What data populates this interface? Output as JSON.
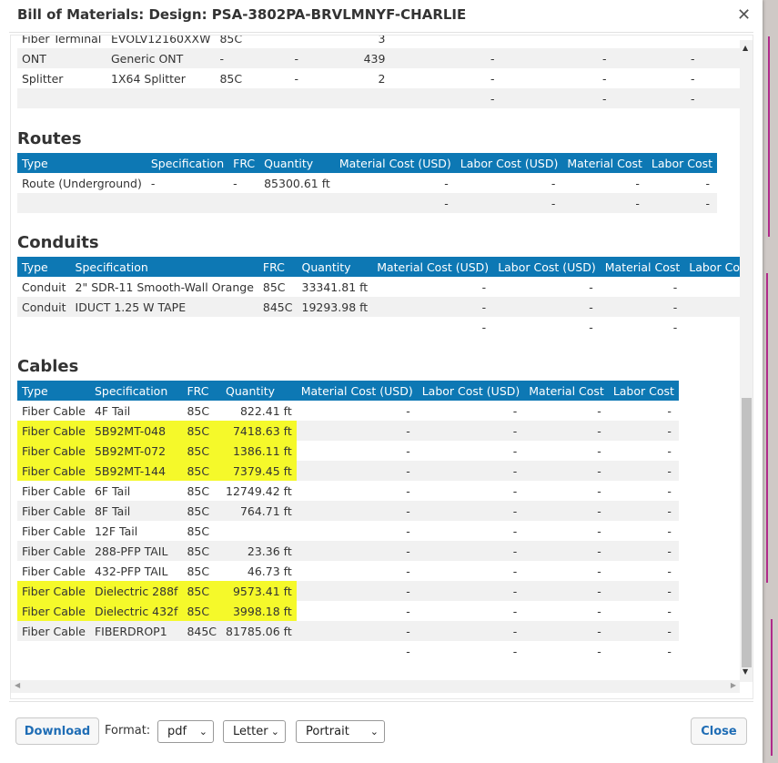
{
  "title": "Bill of Materials: Design: PSA-3802PA-BRVLMNYF-CHARLIE",
  "top_partial": {
    "rows": [
      [
        "Fiber Terminal",
        "EVOLV12160XXW",
        "85C",
        "",
        "3",
        "",
        "",
        "",
        ""
      ],
      [
        "ONT",
        "Generic ONT",
        "-",
        "-",
        "439",
        "-",
        "-",
        "-",
        "-"
      ],
      [
        "Splitter",
        "1X64 Splitter",
        "85C",
        "-",
        "2",
        "-",
        "-",
        "-",
        "-"
      ],
      [
        "",
        "",
        "",
        "",
        "",
        "-",
        "-",
        "-",
        "-"
      ]
    ]
  },
  "routes": {
    "heading": "Routes",
    "columns": [
      "Type",
      "Specification",
      "FRC",
      "Quantity",
      "Material Cost (USD)",
      "Labor Cost (USD)",
      "Material Cost",
      "Labor Cost"
    ],
    "rows": [
      [
        "Route (Underground)",
        "-",
        "-",
        "85300.61 ft",
        "-",
        "-",
        "-",
        "-"
      ],
      [
        "",
        "",
        "",
        "",
        "-",
        "-",
        "-",
        "-"
      ]
    ]
  },
  "conduits": {
    "heading": "Conduits",
    "columns": [
      "Type",
      "Specification",
      "FRC",
      "Quantity",
      "Material Cost (USD)",
      "Labor Cost (USD)",
      "Material Cost",
      "Labor Cost"
    ],
    "rows": [
      [
        "Conduit",
        "2\" SDR-11 Smooth-Wall Orange",
        "85C",
        "33341.81 ft",
        "-",
        "-",
        "-",
        "-"
      ],
      [
        "Conduit",
        "IDUCT 1.25 W TAPE",
        "845C",
        "19293.98 ft",
        "-",
        "-",
        "-",
        "-"
      ],
      [
        "",
        "",
        "",
        "",
        "-",
        "-",
        "-",
        "-"
      ]
    ]
  },
  "cables": {
    "heading": "Cables",
    "columns": [
      "Type",
      "Specification",
      "FRC",
      "Quantity",
      "Material Cost (USD)",
      "Labor Cost (USD)",
      "Material Cost",
      "Labor Cost"
    ],
    "rows": [
      [
        "Fiber Cable",
        "4F Tail",
        "85C",
        "822.41 ft",
        "-",
        "-",
        "-",
        "-"
      ],
      [
        "Fiber Cable",
        "5B92MT-048",
        "85C",
        "7418.63 ft",
        "-",
        "-",
        "-",
        "-"
      ],
      [
        "Fiber Cable",
        "5B92MT-072",
        "85C",
        "1386.11 ft",
        "-",
        "-",
        "-",
        "-"
      ],
      [
        "Fiber Cable",
        "5B92MT-144",
        "85C",
        "7379.45 ft",
        "-",
        "-",
        "-",
        "-"
      ],
      [
        "Fiber Cable",
        "6F Tail",
        "85C",
        "12749.42 ft",
        "-",
        "-",
        "-",
        "-"
      ],
      [
        "Fiber Cable",
        "8F Tail",
        "85C",
        "764.71 ft",
        "-",
        "-",
        "-",
        "-"
      ],
      [
        "Fiber Cable",
        "12F Tail",
        "85C",
        "",
        "-",
        "-",
        "-",
        "-"
      ],
      [
        "Fiber Cable",
        "288-PFP TAIL",
        "85C",
        "23.36 ft",
        "-",
        "-",
        "-",
        "-"
      ],
      [
        "Fiber Cable",
        "432-PFP TAIL",
        "85C",
        "46.73 ft",
        "-",
        "-",
        "-",
        "-"
      ],
      [
        "Fiber Cable",
        "Dielectric 288f",
        "85C",
        "9573.41 ft",
        "-",
        "-",
        "-",
        "-"
      ],
      [
        "Fiber Cable",
        "Dielectric 432f",
        "85C",
        "3998.18 ft",
        "-",
        "-",
        "-",
        "-"
      ],
      [
        "Fiber Cable",
        "FIBERDROP1",
        "845C",
        "81785.06 ft",
        "-",
        "-",
        "-",
        "-"
      ],
      [
        "",
        "",
        "",
        "",
        "-",
        "-",
        "-",
        "-"
      ]
    ],
    "highlighted_rows": [
      1,
      2,
      3,
      9,
      10
    ],
    "highlight_color": "#f5f92a"
  },
  "footer": {
    "download_label": "Download",
    "format_label": "Format:",
    "format_value": "pdf",
    "paper_value": "Letter",
    "orientation_value": "Portrait",
    "close_label": "Close"
  },
  "colors": {
    "header_bg": "#0d78b4",
    "accent": "#1f6db5",
    "zebra": "#f1f1f1"
  }
}
